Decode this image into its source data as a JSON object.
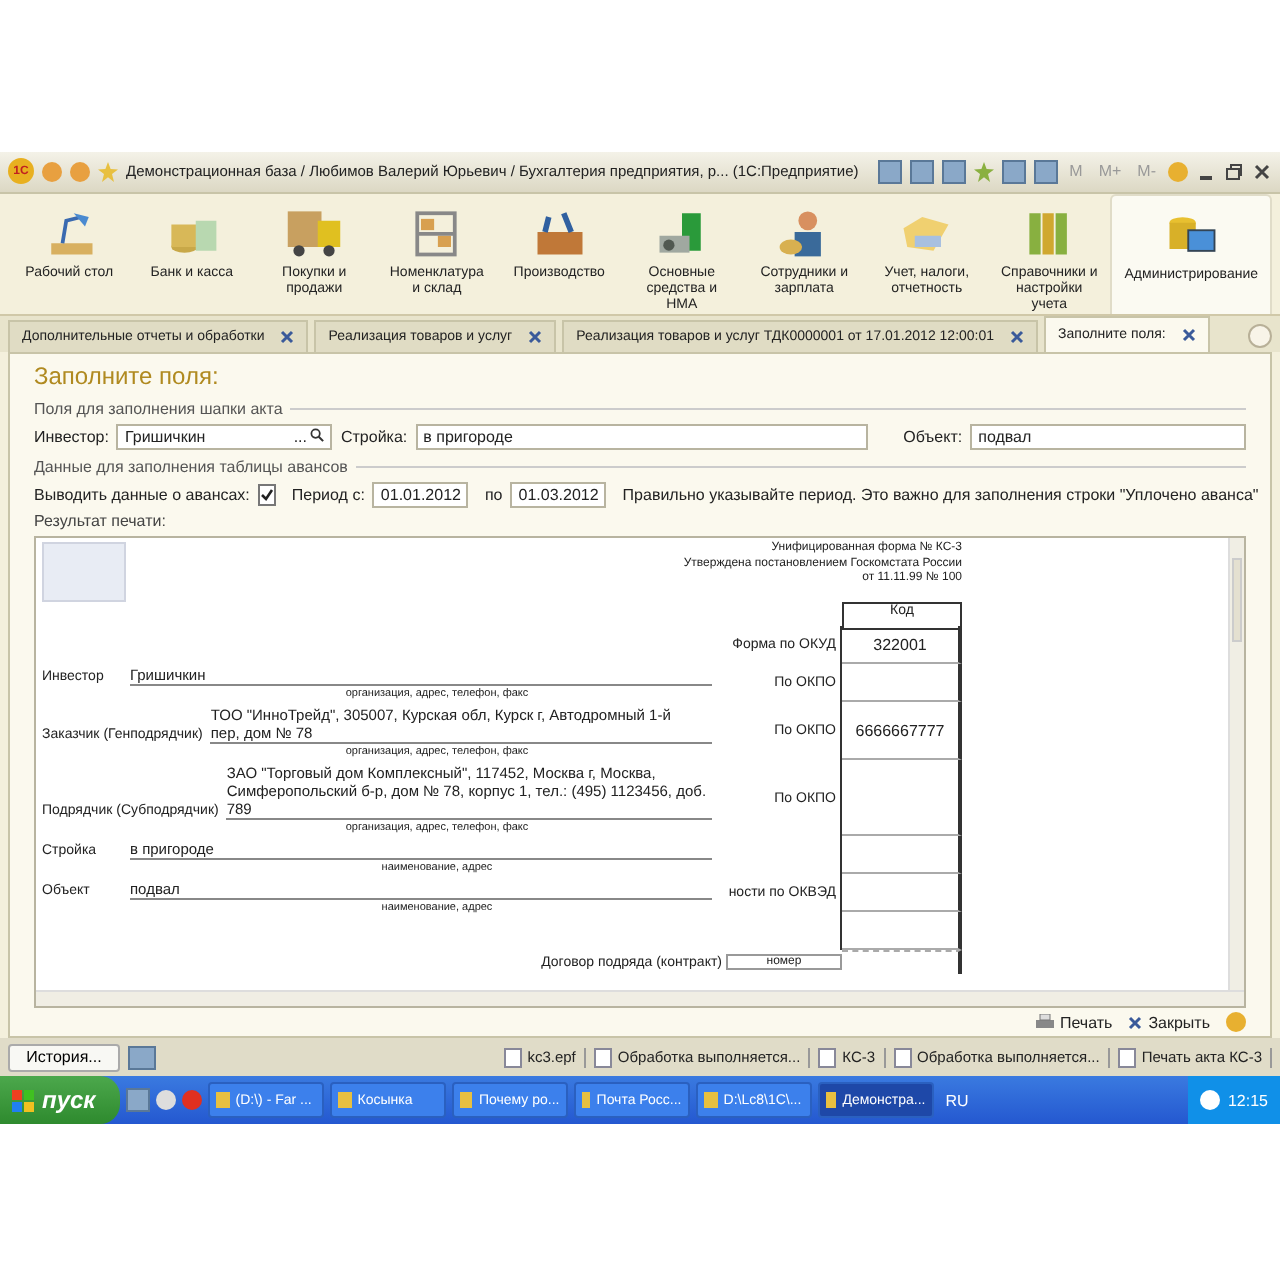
{
  "window": {
    "logo": "1С",
    "title": "Демонстрационная база / Любимов Валерий Юрьевич / Бухгалтерия предприятия, р...  (1С:Предприятие)",
    "memory_buttons": [
      "M",
      "M+",
      "M-"
    ]
  },
  "sections": [
    {
      "label": "Рабочий стол",
      "selected": false
    },
    {
      "label": "Банк и касса",
      "selected": false
    },
    {
      "label": "Покупки и продажи",
      "selected": false
    },
    {
      "label": "Номенклатура и склад",
      "selected": false
    },
    {
      "label": "Производство",
      "selected": false
    },
    {
      "label": "Основные средства и НМА",
      "selected": false
    },
    {
      "label": "Сотрудники и зарплата",
      "selected": false
    },
    {
      "label": "Учет, налоги, отчетность",
      "selected": false
    },
    {
      "label": "Справочники и настройки учета",
      "selected": false
    },
    {
      "label": "Администрирование",
      "selected": true
    }
  ],
  "tabs": [
    {
      "label": "Дополнительные отчеты и обработки",
      "selected": false
    },
    {
      "label": "Реализация товаров и услуг",
      "selected": false
    },
    {
      "label": "Реализация товаров и услуг ТДК0000001 от 17.01.2012 12:00:01",
      "selected": false
    },
    {
      "label": "Заполните поля:",
      "selected": true
    }
  ],
  "form": {
    "heading": "Заполните поля:",
    "group_header": "Поля для заполнения шапки акта",
    "investor": {
      "label": "Инвестор:",
      "value": "Гришичкин",
      "select": "..."
    },
    "site": {
      "label": "Стройка:",
      "value": "в пригороде"
    },
    "object": {
      "label": "Объект:",
      "value": "подвал"
    },
    "group_advances": "Данные для заполнения таблицы авансов",
    "show_advances": {
      "label": "Выводить данные о авансах:",
      "checked": true
    },
    "period": {
      "from_label": "Период с:",
      "from": "01.01.2012",
      "to_label": "по",
      "to": "01.03.2012"
    },
    "hint": "Правильно указывайте период. Это важно для заполнения строки \"Уплочено аванса\"",
    "result_label": "Результат печати:"
  },
  "report": {
    "header_lines": [
      "Унифицированная форма № КС-3",
      "Утверждена постановлением  Госкомстата России",
      "от 11.11.99 № 100"
    ],
    "rows": [
      {
        "label": "Инвестор",
        "lines": [
          "Гришичкин"
        ],
        "caption": "организация, адрес, телефон, факс"
      },
      {
        "label": "Заказчик (Генподрядчик)",
        "lines": [
          "ТОО \"ИнноТрейд\", 305007, Курская обл, Курск г, Автодромный 1-й",
          "пер, дом № 78"
        ],
        "caption": "организация, адрес, телефон, факс"
      },
      {
        "label": "Подрядчик (Субподрядчик)",
        "lines": [
          "ЗАО \"Торговый дом Комплексный\", 117452, Москва г, Москва,",
          "Симферопольский б-р, дом № 78, корпус 1, тел.: (495) 1123456, доб.",
          "789"
        ],
        "caption": "организация, адрес, телефон, факс"
      },
      {
        "label": "Стройка",
        "lines": [
          "в пригороде"
        ],
        "caption": "наименование, адрес"
      },
      {
        "label": "Объект",
        "lines": [
          "подвал"
        ],
        "caption": "наименование, адрес"
      }
    ],
    "codes_title": "Код",
    "codes": [
      {
        "label": "Форма по ОКУД",
        "value": "322001"
      },
      {
        "label": "По ОКПО"
      },
      {
        "label": "По ОКПО",
        "value": "6666667777"
      },
      {
        "label": "По ОКПО"
      },
      {
        "label": "ности по ОКВЭД"
      }
    ],
    "contract": {
      "label": "Договор подряда (контракт)",
      "field": "номер"
    }
  },
  "footer": {
    "print": "Печать",
    "close": "Закрыть"
  },
  "status_bar": {
    "history": "История...",
    "items": [
      "kc3.epf",
      "Обработка выполняется...",
      "КС-3",
      "Обработка выполняется...",
      "Печать акта КС-3"
    ]
  },
  "taskbar": {
    "start": "пуск",
    "tasks": [
      {
        "label": "(D:\\) - Far ...",
        "selected": false
      },
      {
        "label": "Косынка",
        "selected": false
      },
      {
        "label": "Почему ро...",
        "selected": false
      },
      {
        "label": "Почта Росс...",
        "selected": false
      },
      {
        "label": "D:\\Lc8\\1C\\...",
        "selected": false
      },
      {
        "label": "Демонстра...",
        "selected": true
      }
    ],
    "language": "RU",
    "time": "12:15"
  }
}
